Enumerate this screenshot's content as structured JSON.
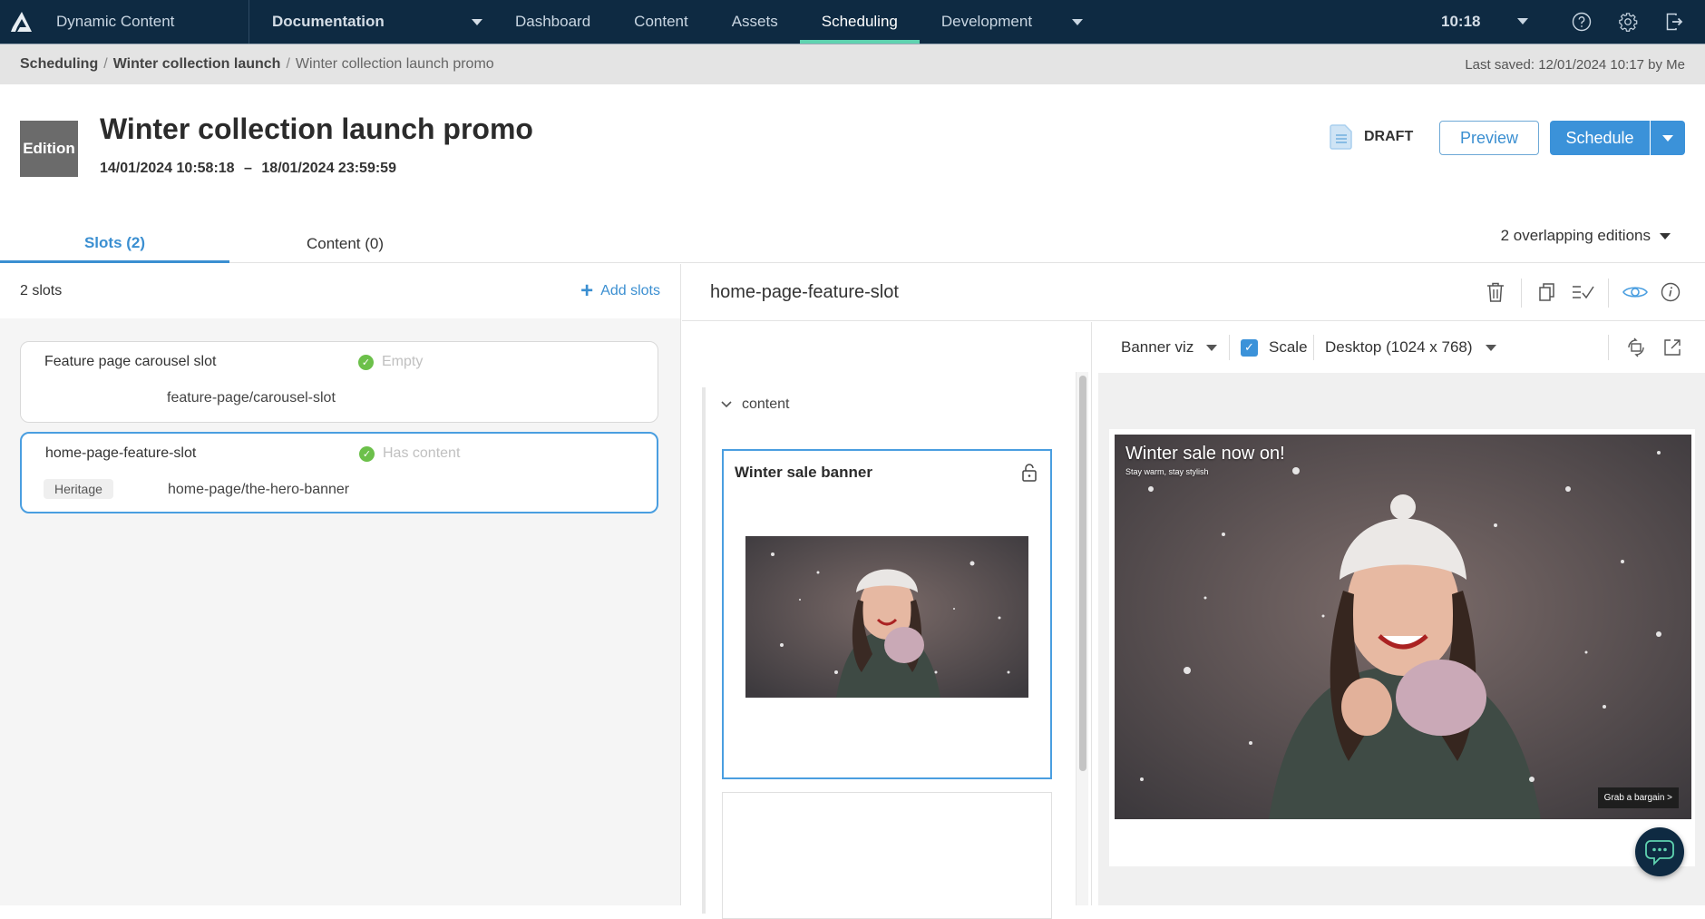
{
  "app": {
    "title": "Dynamic Content",
    "hub": "Documentation",
    "nav": [
      {
        "label": "Dashboard",
        "active": false
      },
      {
        "label": "Content",
        "active": false
      },
      {
        "label": "Assets",
        "active": false
      },
      {
        "label": "Scheduling",
        "active": true
      },
      {
        "label": "Development",
        "active": false
      }
    ],
    "time": "10:18",
    "icons": [
      "help-icon",
      "settings-icon",
      "logout-icon"
    ]
  },
  "breadcrumb": {
    "items": [
      "Scheduling",
      "Winter collection launch"
    ],
    "current": "Winter collection launch promo",
    "separator": "/",
    "last_saved": "Last saved: 12/01/2024 10:17 by Me"
  },
  "edition": {
    "badge": "Edition",
    "title": "Winter collection launch promo",
    "start": "14/01/2024 10:58:18",
    "dash": "–",
    "end": "18/01/2024 23:59:59",
    "status": "DRAFT",
    "preview_label": "Preview",
    "schedule_label": "Schedule"
  },
  "tabs": [
    {
      "label": "Slots (2)",
      "active": true
    },
    {
      "label": "Content (0)",
      "active": false
    }
  ],
  "overlapping": "2 overlapping editions",
  "slots_panel": {
    "count_label": "2 slots",
    "add_label": "Add slots",
    "slots": [
      {
        "name": "Feature page carousel slot",
        "status": "Empty",
        "path": "feature-page/carousel-slot",
        "tag": null,
        "selected": false
      },
      {
        "name": "home-page-feature-slot",
        "status": "Has content",
        "path": "home-page/the-hero-banner",
        "tag": "Heritage",
        "selected": true
      }
    ]
  },
  "detail": {
    "slot_name": "home-page-feature-slot",
    "section_label": "content",
    "card_title": "Winter sale banner"
  },
  "preview": {
    "visualization": "Banner viz",
    "scale_label": "Scale",
    "scale_checked": true,
    "device": "Desktop (1024 x 768)",
    "banner": {
      "headline": "Winter sale now on!",
      "subline": "Stay warm, stay stylish",
      "cta": "Grab a bargain >"
    }
  },
  "colors": {
    "nav_bg": "#0e2a42",
    "accent": "#3b92d9",
    "active_tab_underline": "#5fd3b0",
    "success": "#6cc04a"
  }
}
